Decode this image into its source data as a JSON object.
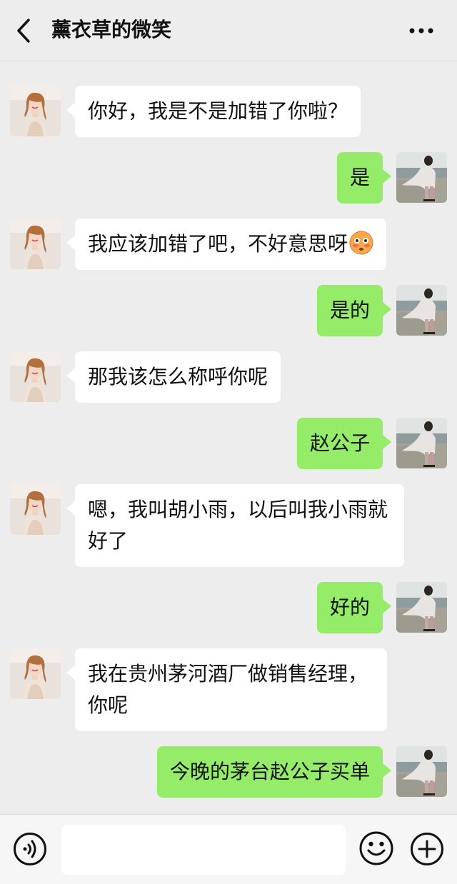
{
  "header": {
    "title": "薰衣草的微笑",
    "back_icon": "chevron-left-icon",
    "more_icon": "more-dots-icon"
  },
  "messages": [
    {
      "from": "contact",
      "text": "你好，我是不是加错了你啦？"
    },
    {
      "from": "me",
      "text": "是"
    },
    {
      "from": "contact",
      "text": "我应该加错了吧，不好意思呀",
      "emoji": "flushed-face-emoji"
    },
    {
      "from": "me",
      "text": "是的"
    },
    {
      "from": "contact",
      "text": "那我该怎么称呼你呢"
    },
    {
      "from": "me",
      "text": "赵公子"
    },
    {
      "from": "contact",
      "text": "嗯，我叫胡小雨，以后叫我小雨就好了"
    },
    {
      "from": "me",
      "text": "好的"
    },
    {
      "from": "contact",
      "text": "我在贵州茅河酒厂做销售经理，你呢"
    },
    {
      "from": "me",
      "text": "今晚的茅台赵公子买单"
    }
  ],
  "footer": {
    "voice_icon": "voice-icon",
    "input_value": "",
    "emoji_icon": "smiley-icon",
    "plus_icon": "plus-circle-icon"
  },
  "colors": {
    "background": "#ededed",
    "incoming_bubble": "#ffffff",
    "outgoing_bubble": "#95ec69"
  }
}
